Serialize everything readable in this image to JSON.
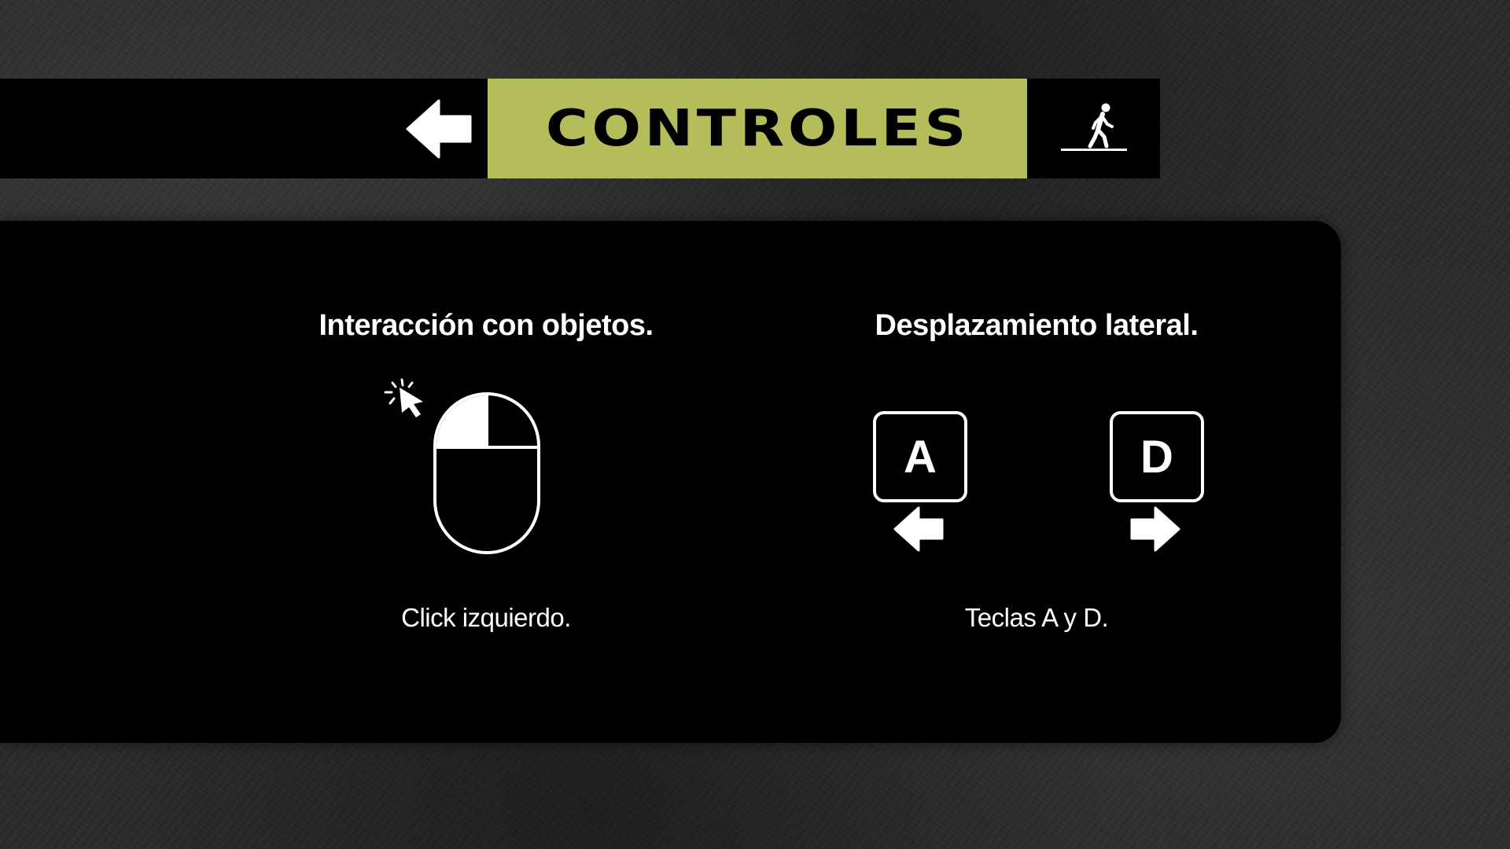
{
  "header": {
    "title": "CONTROLES",
    "title_bg_color": "#b5bc5a",
    "back_icon": "arrow-left-icon",
    "exit_icon": "walking-person-icon"
  },
  "sections": [
    {
      "heading": "Interacción con objetos.",
      "icon": "mouse-left-click-icon",
      "caption": "Click izquierdo."
    },
    {
      "heading": "Desplazamiento lateral.",
      "keys": [
        {
          "label": "A",
          "arrow_icon": "arrow-left-icon"
        },
        {
          "label": "D",
          "arrow_icon": "arrow-right-icon"
        }
      ],
      "caption": "Teclas A y D."
    }
  ]
}
